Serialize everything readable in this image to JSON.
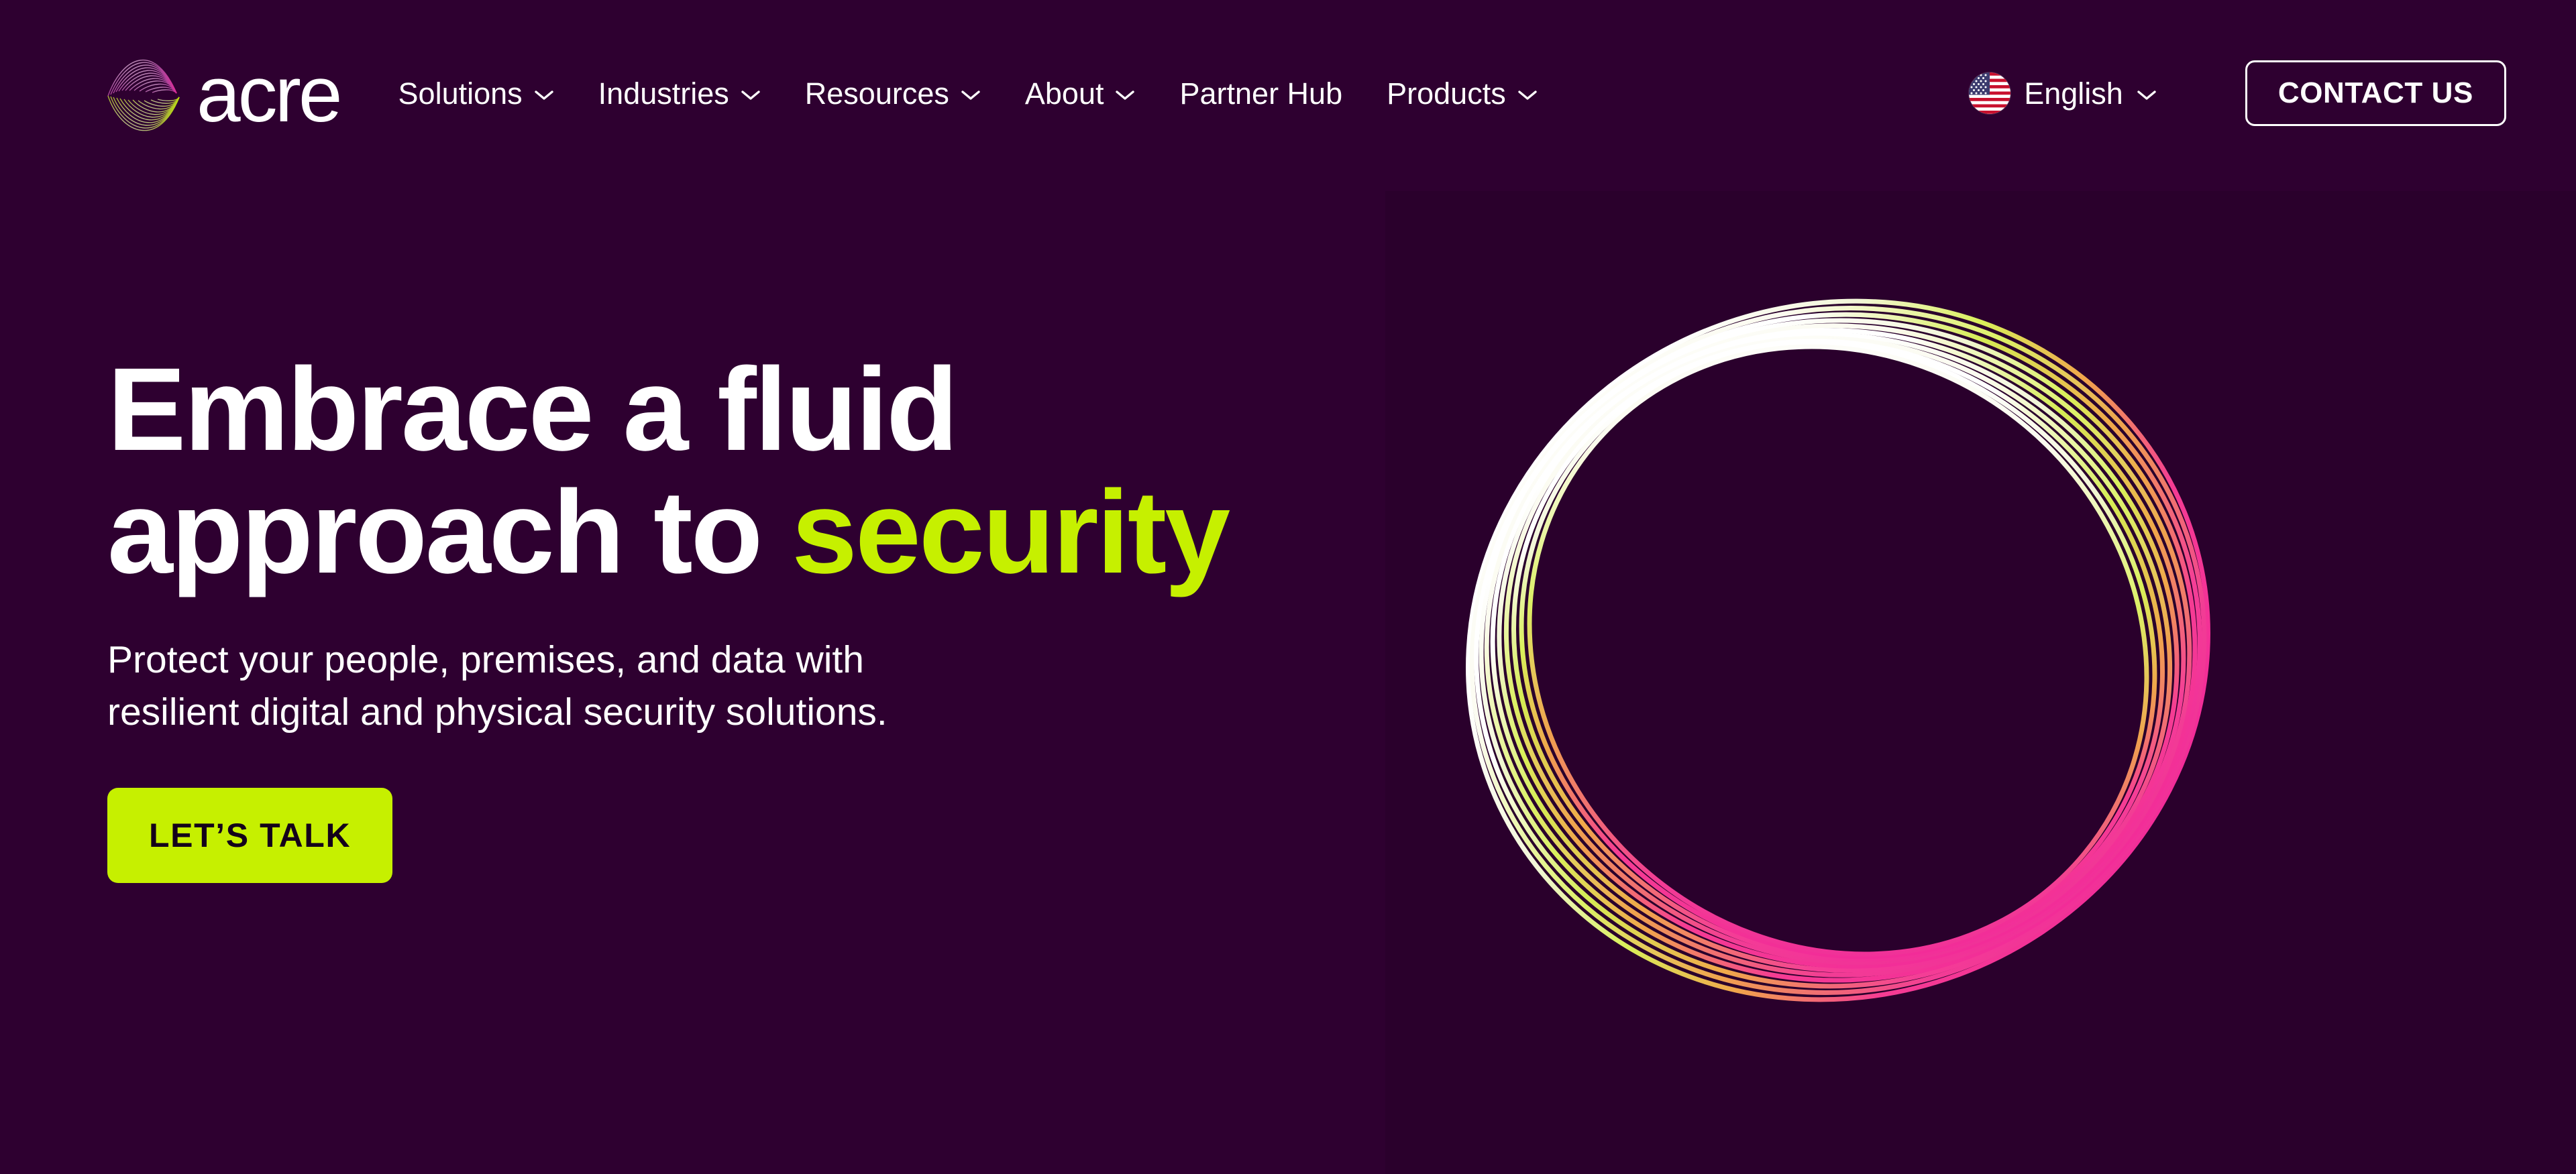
{
  "theme": {
    "background": "#2E0030",
    "panel": "#2A002C",
    "accent_green": "#C6F000",
    "accent_magenta": "#F0239B",
    "text_light": "#FFFFFF",
    "button_text_dark": "#14001A"
  },
  "header": {
    "brand": {
      "name": "acre",
      "mark_icon": "acre-butterfly-logo-icon"
    },
    "nav_items": [
      {
        "label": "Solutions",
        "has_dropdown": true,
        "caret_icon": "chevron-down-icon"
      },
      {
        "label": "Industries",
        "has_dropdown": true,
        "caret_icon": "chevron-down-icon"
      },
      {
        "label": "Resources",
        "has_dropdown": true,
        "caret_icon": "chevron-down-icon"
      },
      {
        "label": "About",
        "has_dropdown": true,
        "caret_icon": "chevron-down-icon"
      },
      {
        "label": "Partner Hub",
        "has_dropdown": false,
        "caret_icon": ""
      },
      {
        "label": "Products",
        "has_dropdown": true,
        "caret_icon": "chevron-down-icon"
      }
    ],
    "language_selector": {
      "label": "English",
      "flag_icon": "us-flag-icon",
      "caret_icon": "chevron-down-icon"
    },
    "contact_button": {
      "label": "CONTACT US"
    }
  },
  "hero": {
    "title_line1": "Embrace a fluid",
    "title_line2_plain": "approach to ",
    "title_line2_accent": "security",
    "subtitle_line1": "Protect your people, premises, and data with",
    "subtitle_line2": "resilient digital and physical security solutions.",
    "cta_label": "LET’S TALK",
    "graphic_icon": "fluid-spiral-rings-graphic"
  }
}
